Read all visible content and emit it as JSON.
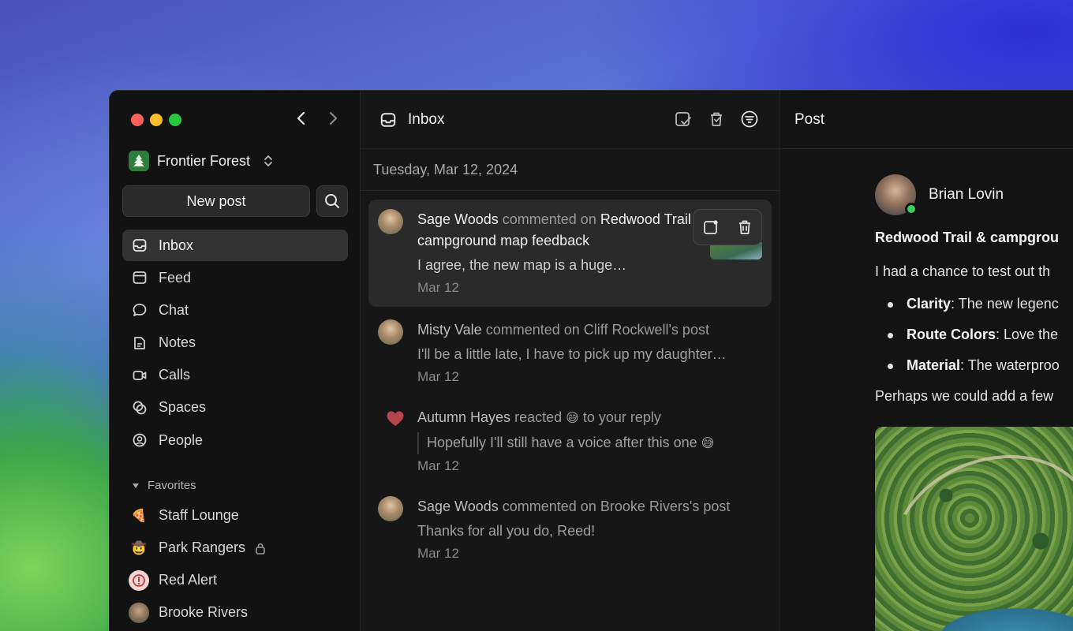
{
  "window_controls": {
    "close": "close",
    "minimize": "minimize",
    "zoom": "zoom"
  },
  "org": {
    "name": "Frontier Forest",
    "logo_icon": "tree-icon"
  },
  "sidebar": {
    "new_post_label": "New post",
    "nav": [
      {
        "label": "Inbox",
        "icon": "inbox-icon",
        "active": true
      },
      {
        "label": "Feed",
        "icon": "feed-icon",
        "active": false
      },
      {
        "label": "Chat",
        "icon": "chat-icon",
        "active": false
      },
      {
        "label": "Notes",
        "icon": "notes-icon",
        "active": false
      },
      {
        "label": "Calls",
        "icon": "video-icon",
        "active": false
      },
      {
        "label": "Spaces",
        "icon": "spaces-icon",
        "active": false
      },
      {
        "label": "People",
        "icon": "person-icon",
        "active": false
      }
    ],
    "favorites_label": "Favorites",
    "favorites": [
      {
        "label": "Staff Lounge",
        "emoji": "🍕"
      },
      {
        "label": "Park Rangers",
        "emoji": "🤠",
        "locked": true
      },
      {
        "label": "Red Alert",
        "icon": "alert-icon"
      },
      {
        "label": "Brooke Rivers",
        "icon": "avatar"
      }
    ]
  },
  "inbox": {
    "title": "Inbox",
    "date_header": "Tuesday, Mar 12, 2024",
    "items": [
      {
        "actor": "Sage Woods",
        "verb": "commented on",
        "target": "Redwood Trail & campground map feedback",
        "preview": "I agree, the new map is a huge…",
        "time": "Mar 12"
      },
      {
        "actor": "Misty Vale",
        "verb": "commented on",
        "target": "Cliff Rockwell's post",
        "preview": "I'll be a little late, I have to pick up my daughter…",
        "time": "Mar 12"
      },
      {
        "actor": "Autumn Hayes",
        "verb": "reacted",
        "emoji": "😅",
        "target": "to your reply",
        "preview": "Hopefully I'll still have a voice after this one",
        "preview_emoji": "😅",
        "time": "Mar 12"
      },
      {
        "actor": "Sage Woods",
        "verb": "commented on",
        "target": "Brooke Rivers's post",
        "preview": "Thanks for all you do, Reed!",
        "time": "Mar 12"
      }
    ]
  },
  "post": {
    "header": "Post",
    "author": "Brian Lovin",
    "title": "Redwood Trail & campgrou",
    "intro": "I had a chance to test out th",
    "bullets": [
      {
        "term": "Clarity",
        "text": ": The new legenc"
      },
      {
        "term": "Route Colors",
        "text": ": Love the"
      },
      {
        "term": "Material",
        "text": ": The waterproo"
      }
    ],
    "closing": "Perhaps we could add a few"
  }
}
